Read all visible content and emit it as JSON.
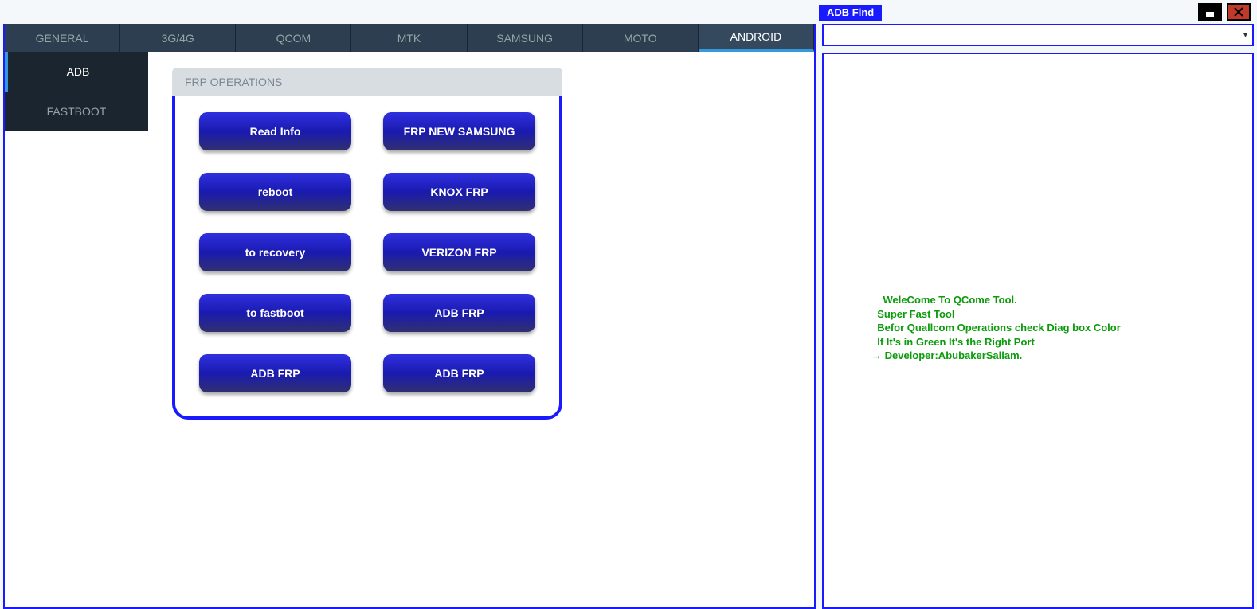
{
  "titlebar": {
    "center_label": "ADB Find"
  },
  "top_tabs": {
    "t0": "GENERAL",
    "t1": "3G/4G",
    "t2": "QCOM",
    "t3": "MTK",
    "t4": "SAMSUNG",
    "t5": "MOTO",
    "t6": "ANDROID"
  },
  "side_tabs": {
    "s0": "ADB",
    "s1": "FASTBOOT"
  },
  "ops_panel": {
    "header": "FRP OPERATIONS",
    "b0": "Read Info",
    "b1": "FRP NEW SAMSUNG",
    "b2": "reboot",
    "b3": "KNOX FRP",
    "b4": "to recovery",
    "b5": "VERIZON FRP",
    "b6": "to fastboot",
    "b7": "ADB FRP",
    "b8": "ADB FRP",
    "b9": "ADB FRP"
  },
  "log": {
    "text": "    WeleCome To QCome Tool.\n  Super Fast Tool\n  Befor Quallcom Operations check Diag box Color\n  If It's in Green It's the Right Port\n→ Developer:AbubakerSallam."
  }
}
